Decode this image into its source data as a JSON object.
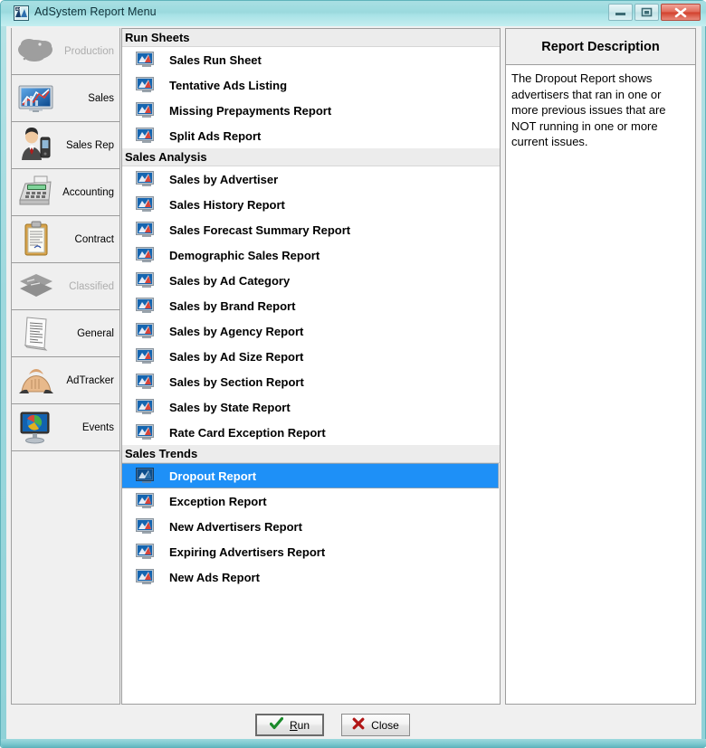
{
  "window": {
    "title": "AdSystem Report Menu",
    "icon": "adsystem-app-icon",
    "controls": [
      {
        "name": "minimize-button",
        "icon": "minimize-icon"
      },
      {
        "name": "maximize-button",
        "icon": "maximize-icon"
      },
      {
        "name": "close-button",
        "icon": "close-x-icon"
      }
    ],
    "frame_color": "#9ed8dd"
  },
  "sidebar": {
    "items": [
      {
        "label": "Production",
        "icon": "production-icon",
        "disabled": true
      },
      {
        "label": "Sales",
        "icon": "sales-chart-icon",
        "disabled": false
      },
      {
        "label": "Sales Rep",
        "icon": "sales-rep-icon",
        "disabled": false
      },
      {
        "label": "Accounting",
        "icon": "accounting-calculator-icon",
        "disabled": false
      },
      {
        "label": "Contract",
        "icon": "contract-clipboard-icon",
        "disabled": false
      },
      {
        "label": "Classified",
        "icon": "classified-papers-icon",
        "disabled": true
      },
      {
        "label": "General",
        "icon": "general-document-icon",
        "disabled": false
      },
      {
        "label": "AdTracker",
        "icon": "adtracker-handshake-icon",
        "disabled": false
      },
      {
        "label": "Events",
        "icon": "events-globe-monitor-icon",
        "disabled": false
      }
    ]
  },
  "report_list": {
    "selected": "Dropout Report",
    "selection_color": "#1e90f7",
    "groups": [
      {
        "title": "Run Sheets",
        "items": [
          {
            "label": "Sales Run Sheet",
            "icon": "report-icon"
          },
          {
            "label": "Tentative Ads Listing",
            "icon": "report-icon"
          },
          {
            "label": "Missing Prepayments Report",
            "icon": "report-icon"
          },
          {
            "label": "Split Ads Report",
            "icon": "report-icon"
          }
        ]
      },
      {
        "title": "Sales Analysis",
        "items": [
          {
            "label": "Sales by Advertiser",
            "icon": "report-icon"
          },
          {
            "label": "Sales History Report",
            "icon": "report-icon"
          },
          {
            "label": "Sales Forecast Summary Report",
            "icon": "report-icon"
          },
          {
            "label": "Demographic Sales Report",
            "icon": "report-icon"
          },
          {
            "label": "Sales by Ad Category",
            "icon": "report-icon"
          },
          {
            "label": "Sales by Brand Report",
            "icon": "report-icon"
          },
          {
            "label": "Sales by Agency Report",
            "icon": "report-icon"
          },
          {
            "label": "Sales by Ad Size Report",
            "icon": "report-icon"
          },
          {
            "label": "Sales by Section Report",
            "icon": "report-icon"
          },
          {
            "label": "Sales by State Report",
            "icon": "report-icon"
          },
          {
            "label": "Rate Card Exception Report",
            "icon": "report-icon"
          }
        ]
      },
      {
        "title": "Sales Trends",
        "items": [
          {
            "label": "Dropout Report",
            "icon": "report-icon"
          },
          {
            "label": "Exception Report",
            "icon": "report-icon"
          },
          {
            "label": "New Advertisers Report",
            "icon": "report-icon"
          },
          {
            "label": "Expiring Advertisers Report",
            "icon": "report-icon"
          },
          {
            "label": "New Ads Report",
            "icon": "report-icon"
          }
        ]
      }
    ]
  },
  "description": {
    "header": "Report Description",
    "text": "The Dropout Report shows advertisers that ran in one or more previous issues that are NOT running in one or more current issues."
  },
  "buttons": {
    "run": {
      "label_prefix": "R",
      "label_rest": "un",
      "icon": "green-check-icon"
    },
    "close": {
      "label": "Close",
      "icon": "red-x-icon"
    }
  }
}
